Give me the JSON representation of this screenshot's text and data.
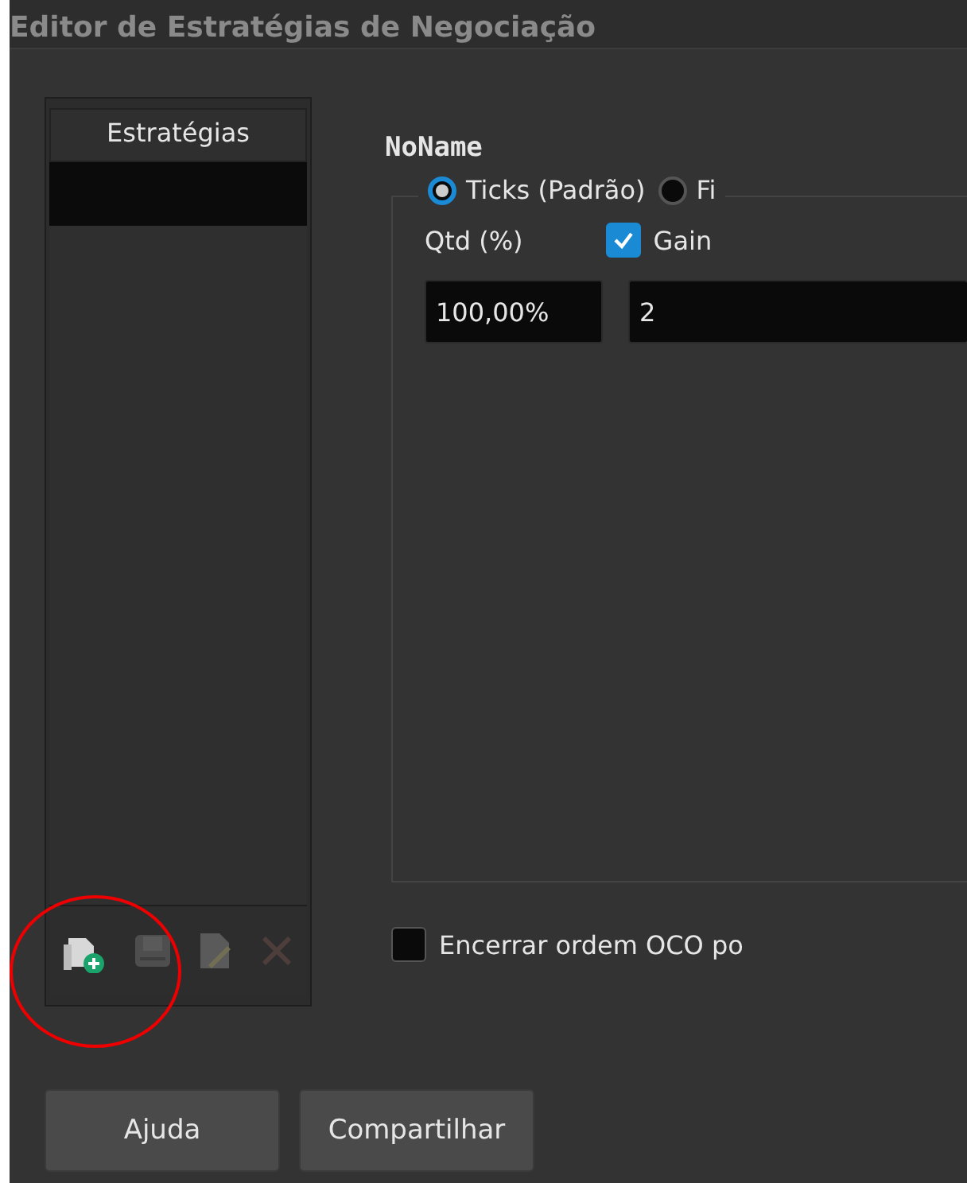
{
  "window": {
    "title": "Editor de Estratégias de Negociação"
  },
  "strategies": {
    "header": "Estratégias",
    "rows": [
      {
        "selected": true
      }
    ],
    "toolbar": [
      {
        "kind": "add",
        "disabled": false
      },
      {
        "kind": "save",
        "disabled": true
      },
      {
        "kind": "edit",
        "disabled": true
      },
      {
        "kind": "delete",
        "disabled": true
      }
    ]
  },
  "editor": {
    "name": "NoName",
    "modes": [
      {
        "label": "Ticks (Padrão)",
        "selected": true
      },
      {
        "label": "Fi",
        "selected": false
      }
    ],
    "qty": {
      "label": "Qtd (%)",
      "value": "100,00%"
    },
    "gain": {
      "label": "Gain",
      "checked": true,
      "value": "2"
    },
    "oco": {
      "label": "Encerrar ordem OCO po",
      "checked": false
    }
  },
  "buttons": [
    "Ajuda",
    "Compartilhar"
  ],
  "annotation": {
    "kind": "circle"
  }
}
